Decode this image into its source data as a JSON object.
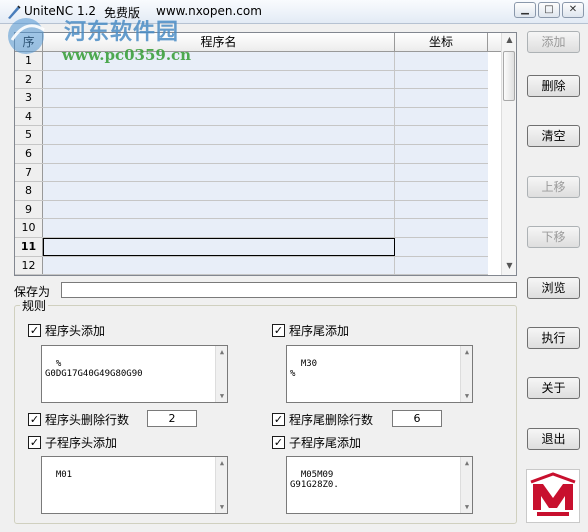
{
  "window": {
    "app_name": "UniteNC 1.2",
    "tag": "免费版",
    "url": "www.nxopen.com",
    "min_icon": "minimize-icon",
    "max_icon": "maximize-icon",
    "close_icon": "close-icon"
  },
  "watermark": {
    "site_name": "河东软件园",
    "site_url": "www.pc0359.cn"
  },
  "grid": {
    "columns": [
      "序",
      "程序名",
      "坐标"
    ],
    "rows": [
      "1",
      "2",
      "3",
      "4",
      "5",
      "6",
      "7",
      "8",
      "9",
      "10",
      "11",
      "12"
    ],
    "selected_row": "11"
  },
  "buttons": {
    "add": "添加",
    "delete": "删除",
    "clear": "清空",
    "move_up": "上移",
    "move_down": "下移",
    "browse": "浏览",
    "execute": "执行",
    "about": "关于",
    "exit": "退出"
  },
  "save": {
    "label": "保存为",
    "value": ""
  },
  "rules": {
    "group_label": "规则",
    "header_add": {
      "label": "程序头添加",
      "checked": true,
      "text": "%\nG0DG17G40G49G80G90"
    },
    "tail_add": {
      "label": "程序尾添加",
      "checked": true,
      "text": "M30\n%"
    },
    "header_delete": {
      "label": "程序头删除行数",
      "checked": true,
      "value": "2"
    },
    "tail_delete": {
      "label": "程序尾删除行数",
      "checked": true,
      "value": "6"
    },
    "sub_header_add": {
      "label": "子程序头添加",
      "checked": true,
      "text": "M01"
    },
    "sub_tail_add": {
      "label": "子程序尾添加",
      "checked": true,
      "text": "M05M09\nG91G28Z0."
    }
  },
  "colors": {
    "row_bg": "#e8eef8",
    "logo_red": "#c8102e"
  }
}
